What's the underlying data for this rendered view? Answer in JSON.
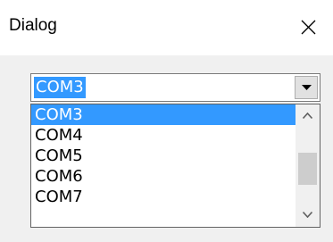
{
  "window": {
    "title": "Dialog",
    "close_icon": "close-icon"
  },
  "combo": {
    "value": "COM3",
    "button_icon": "dropdown-arrow-icon"
  },
  "dropdown": {
    "items": [
      "COM3",
      "COM4",
      "COM5",
      "COM6",
      "COM7"
    ],
    "selected_index": 0
  },
  "scrollbar": {
    "up_icon": "chevron-up-icon",
    "down_icon": "chevron-down-icon"
  },
  "colors": {
    "selection": "#3399ff",
    "client_bg": "#f0f0f0",
    "thumb": "#cdcdcd"
  }
}
